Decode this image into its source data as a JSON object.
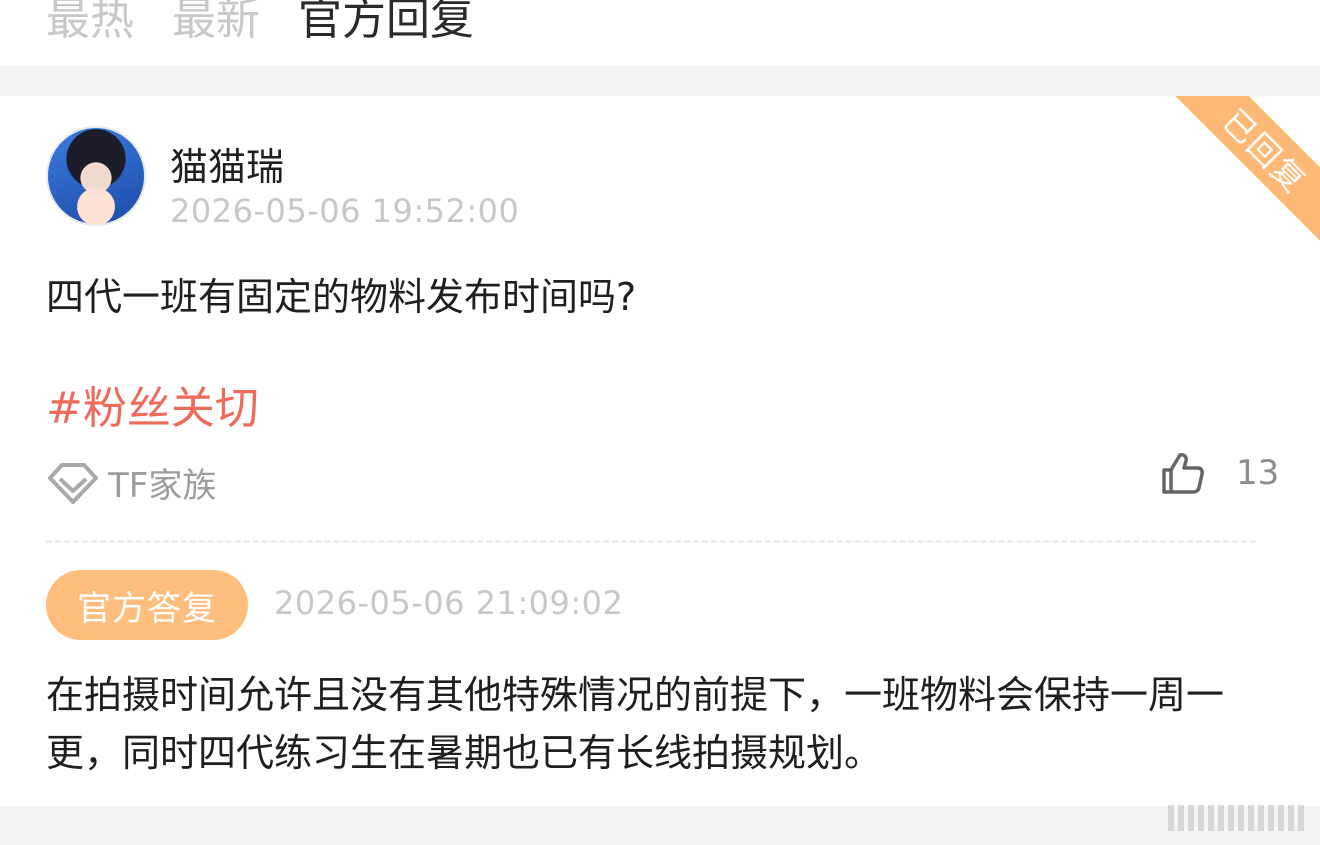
{
  "tabs": [
    {
      "label": "最热"
    },
    {
      "label": "最新"
    },
    {
      "label": "官方回复"
    }
  ],
  "post": {
    "ribbon": "已回复",
    "user": {
      "name": "猫猫瑞"
    },
    "timestamp": "2026-05-06 19:52:00",
    "question": "四代一班有固定的物料发布时间吗?",
    "topic": "#粉丝关切",
    "source": {
      "label": "TF家族",
      "icon": "diamond-badge-icon"
    },
    "likes": {
      "count": "13",
      "icon": "thumbs-up-icon"
    },
    "reply": {
      "badge": "官方答复",
      "timestamp": "2026-05-06 21:09:02",
      "text": "在拍摄时间允许且没有其他特殊情况的前提下，一班物料会保持一周一更，同时四代练习生在暑期也已有长线拍摄规划。"
    }
  },
  "colors": {
    "topic": "#ee6a5a",
    "badge": "#ffbe7e",
    "ribbon": "#ffb976"
  }
}
